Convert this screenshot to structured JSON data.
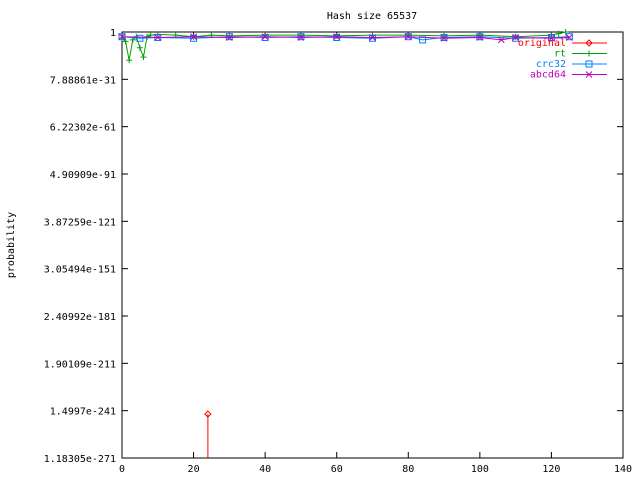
{
  "chart_data": {
    "type": "line",
    "title": "Hash size 65537",
    "xlabel": "",
    "ylabel": "probability",
    "y_scale": "log10",
    "xlim": [
      0,
      140
    ],
    "x_ticks": [
      "0",
      "20",
      "40",
      "60",
      "80",
      "100",
      "120",
      "140"
    ],
    "y_tick_labels": [
      "1.18305e-271",
      "1.4997e-241",
      "1.90109e-211",
      "2.40992e-181",
      "3.05494e-151",
      "3.87259e-121",
      "4.90909e-91",
      "6.22302e-61",
      "7.88861e-31",
      "1"
    ],
    "ylim_log10": [
      -270.927,
      0
    ],
    "legend_position": "top-right",
    "grid": false,
    "series": [
      {
        "name": "original",
        "color": "#ff0000",
        "marker": "diamond",
        "points": [
          [
            24,
            -243
          ],
          [
            24,
            -275
          ]
        ]
      },
      {
        "name": "rt",
        "color": "#00a000",
        "marker": "plus",
        "points": [
          [
            0,
            -4
          ],
          [
            1,
            -6
          ],
          [
            2,
            -18
          ],
          [
            3,
            -5
          ],
          [
            4,
            -3
          ],
          [
            5,
            -10
          ],
          [
            6,
            -16
          ],
          [
            7,
            -3
          ],
          [
            8,
            -2
          ],
          [
            10,
            -1.5
          ],
          [
            15,
            -2
          ],
          [
            20,
            -3
          ],
          [
            25,
            -2
          ],
          [
            30,
            -2.5
          ],
          [
            40,
            -2
          ],
          [
            50,
            -2
          ],
          [
            60,
            -2.5
          ],
          [
            70,
            -2
          ],
          [
            80,
            -2
          ],
          [
            90,
            -2.5
          ],
          [
            100,
            -2
          ],
          [
            110,
            -3
          ],
          [
            120,
            -2
          ],
          [
            122,
            -1
          ],
          [
            124,
            0
          ]
        ]
      },
      {
        "name": "crc32",
        "color": "#0080ff",
        "marker": "square",
        "points": [
          [
            0,
            -3
          ],
          [
            5,
            -4
          ],
          [
            10,
            -3.5
          ],
          [
            20,
            -4
          ],
          [
            30,
            -3
          ],
          [
            40,
            -3.5
          ],
          [
            50,
            -3
          ],
          [
            60,
            -3.5
          ],
          [
            70,
            -4
          ],
          [
            80,
            -3
          ],
          [
            84,
            -5
          ],
          [
            90,
            -3.5
          ],
          [
            100,
            -3
          ],
          [
            110,
            -4
          ],
          [
            120,
            -3.5
          ],
          [
            125,
            -3
          ]
        ]
      },
      {
        "name": "abcd64",
        "color": "#c000c0",
        "marker": "cross",
        "points": [
          [
            0,
            -3
          ],
          [
            10,
            -3.5
          ],
          [
            20,
            -3
          ],
          [
            30,
            -3.5
          ],
          [
            40,
            -3
          ],
          [
            50,
            -3.5
          ],
          [
            60,
            -3
          ],
          [
            70,
            -3.5
          ],
          [
            80,
            -3
          ],
          [
            90,
            -4
          ],
          [
            100,
            -3.5
          ],
          [
            106,
            -5
          ],
          [
            110,
            -3.5
          ],
          [
            120,
            -4
          ],
          [
            125,
            -3.5
          ]
        ]
      }
    ]
  }
}
